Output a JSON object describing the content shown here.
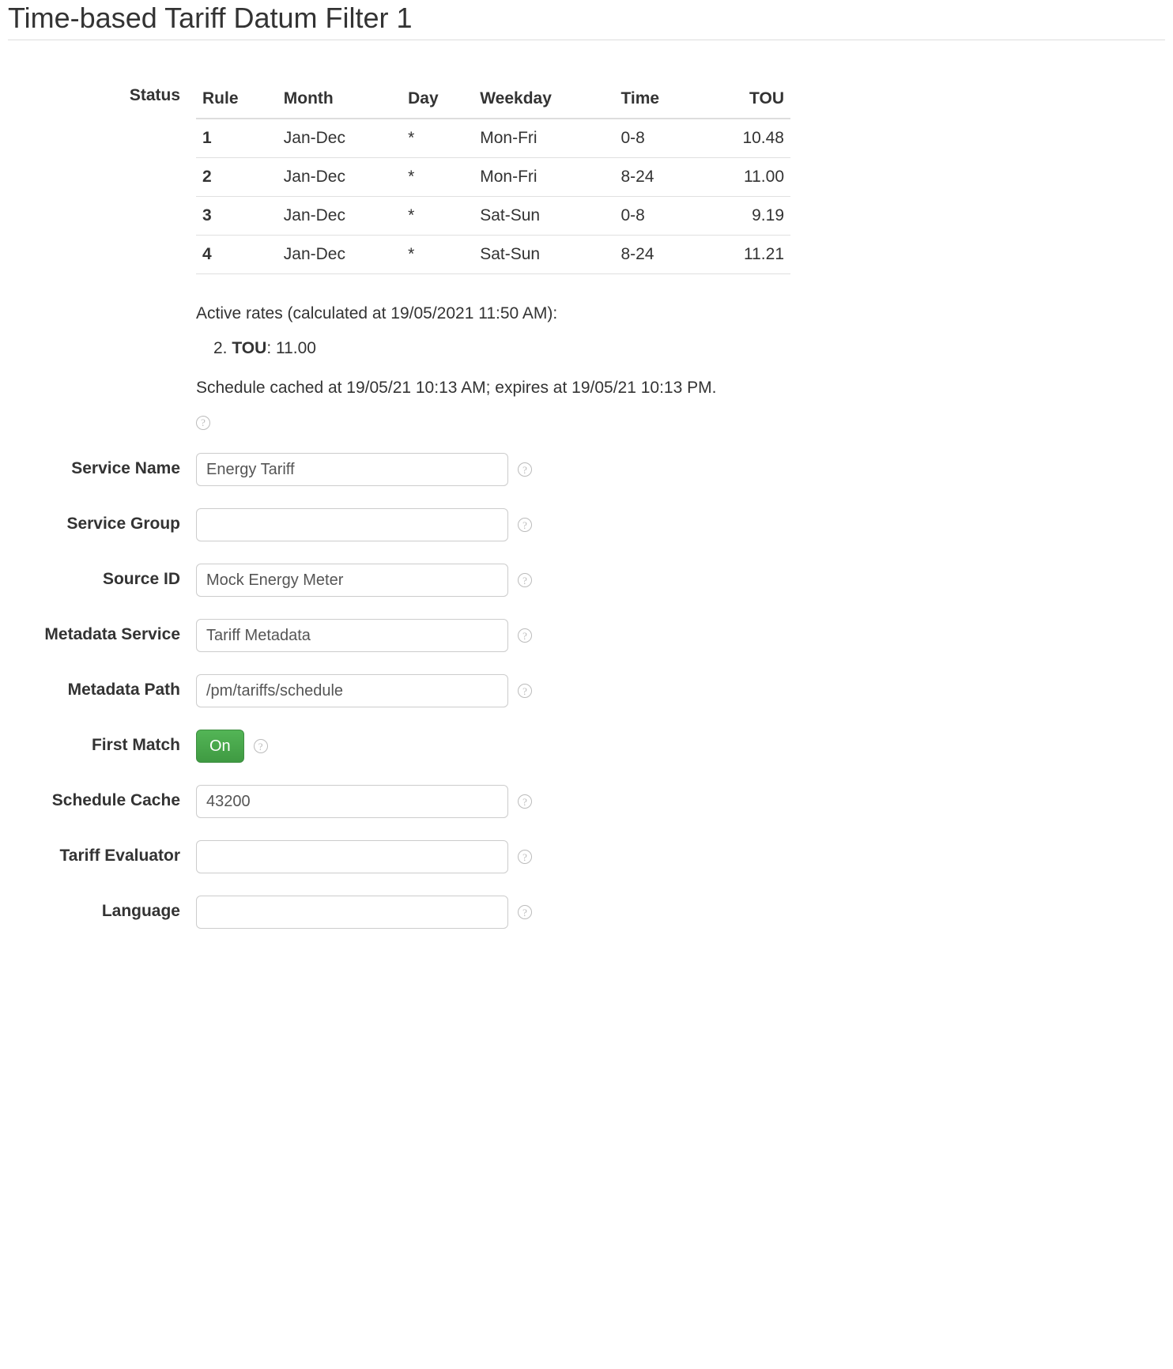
{
  "title": "Time-based Tariff Datum Filter 1",
  "labels": {
    "status": "Status",
    "service_name": "Service Name",
    "service_group": "Service Group",
    "source_id": "Source ID",
    "metadata_service": "Metadata Service",
    "metadata_path": "Metadata Path",
    "first_match": "First Match",
    "schedule_cache": "Schedule Cache",
    "tariff_evaluator": "Tariff Evaluator",
    "language": "Language"
  },
  "status": {
    "columns": [
      "Rule",
      "Month",
      "Day",
      "Weekday",
      "Time",
      "TOU"
    ],
    "rows": [
      {
        "rule": "1",
        "month": "Jan-Dec",
        "day": "*",
        "weekday": "Mon-Fri",
        "time": "0-8",
        "tou": "10.48"
      },
      {
        "rule": "2",
        "month": "Jan-Dec",
        "day": "*",
        "weekday": "Mon-Fri",
        "time": "8-24",
        "tou": "11.00"
      },
      {
        "rule": "3",
        "month": "Jan-Dec",
        "day": "*",
        "weekday": "Sat-Sun",
        "time": "0-8",
        "tou": "9.19"
      },
      {
        "rule": "4",
        "month": "Jan-Dec",
        "day": "*",
        "weekday": "Sat-Sun",
        "time": "8-24",
        "tou": "11.21"
      }
    ],
    "active_rates_caption": "Active rates (calculated at 19/05/2021 11:50 AM):",
    "active_rate": {
      "index": "2.",
      "label": "TOU",
      "value": "11.00"
    },
    "cache_caption": "Schedule cached at 19/05/21 10:13 AM; expires at 19/05/21 10:13 PM."
  },
  "fields": {
    "service_name": "Energy Tariff",
    "service_group": "",
    "source_id": "Mock Energy Meter",
    "metadata_service": "Tariff Metadata",
    "metadata_path": "/pm/tariffs/schedule",
    "first_match": "On",
    "schedule_cache": "43200",
    "tariff_evaluator": "",
    "language": ""
  },
  "help_glyph": "?"
}
